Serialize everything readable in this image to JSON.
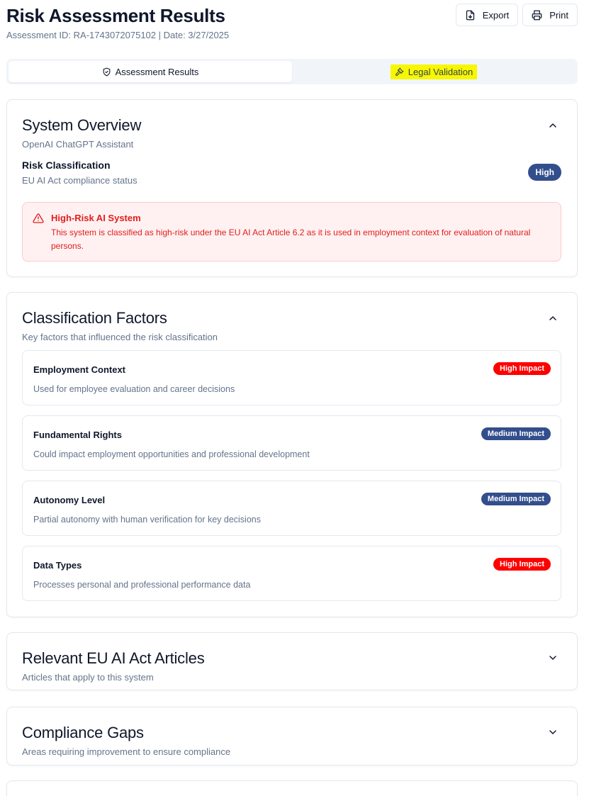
{
  "header": {
    "title": "Risk Assessment Results",
    "subtitle": "Assessment ID: RA-1743072075102 | Date: 3/27/2025",
    "export_label": "Export",
    "print_label": "Print"
  },
  "tabs": [
    {
      "label": "Assessment Results",
      "icon": "shield-check-icon",
      "active": true
    },
    {
      "label": "Legal Validation",
      "icon": "gavel-icon",
      "active": false
    }
  ],
  "system_overview": {
    "title": "System Overview",
    "system_name": "OpenAI ChatGPT Assistant",
    "risk_label": "Risk Classification",
    "risk_sub": "EU AI Act compliance status",
    "risk_level": "High",
    "alert": {
      "title": "High-Risk AI System",
      "text": "This system is classified as high-risk under the EU AI Act Article 6.2 as it is used in employment context for evaluation of natural persons."
    }
  },
  "classification_factors": {
    "title": "Classification Factors",
    "description": "Key factors that influenced the risk classification",
    "items": [
      {
        "name": "Employment Context",
        "description": "Used for employee evaluation and career decisions",
        "impact": "High Impact",
        "level": "high"
      },
      {
        "name": "Fundamental Rights",
        "description": "Could impact employment opportunities and professional development",
        "impact": "Medium Impact",
        "level": "medium"
      },
      {
        "name": "Autonomy Level",
        "description": "Partial autonomy with human verification for key decisions",
        "impact": "Medium Impact",
        "level": "medium"
      },
      {
        "name": "Data Types",
        "description": "Processes personal and professional performance data",
        "impact": "High Impact",
        "level": "high"
      }
    ]
  },
  "relevant_articles": {
    "title": "Relevant EU AI Act Articles",
    "description": "Articles that apply to this system"
  },
  "compliance_gaps": {
    "title": "Compliance Gaps",
    "description": "Areas requiring improvement to ensure compliance"
  },
  "colors": {
    "accent": "#334e8c",
    "danger": "#ff0000",
    "alert_text": "#e11d1d",
    "alert_bg": "#fff1f1",
    "tab_highlight": "#f7f700"
  }
}
